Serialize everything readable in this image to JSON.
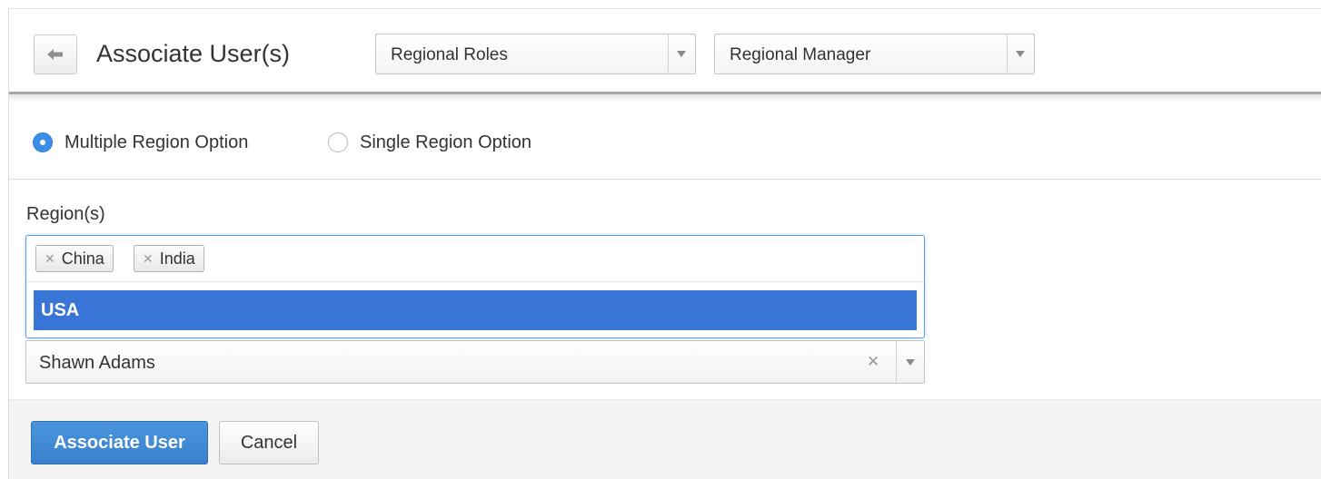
{
  "header": {
    "back_icon": "arrow-left-icon",
    "title": "Associate User(s)",
    "role_type_select": {
      "value": "Regional Roles"
    },
    "role_select": {
      "value": "Regional Manager"
    }
  },
  "region_mode": {
    "options": [
      {
        "label": "Multiple Region Option",
        "selected": true
      },
      {
        "label": "Single Region Option",
        "selected": false
      }
    ]
  },
  "regions": {
    "label": "Region(s)",
    "selected_tags": [
      {
        "label": "China",
        "remove_icon": "close-icon"
      },
      {
        "label": "India",
        "remove_icon": "close-icon"
      }
    ],
    "dropdown_options": [
      {
        "label": "USA",
        "highlighted": true
      }
    ]
  },
  "user_select": {
    "value": "Shawn Adams",
    "clear_icon": "close-icon",
    "arrow_icon": "chevron-down-icon"
  },
  "actions": {
    "associate_label": "Associate User",
    "cancel_label": "Cancel"
  },
  "colors": {
    "primary": "#3a80cc",
    "highlight": "#3875d7",
    "radio_selected": "#3a8ee6",
    "focus_border": "#5b9ee6"
  }
}
